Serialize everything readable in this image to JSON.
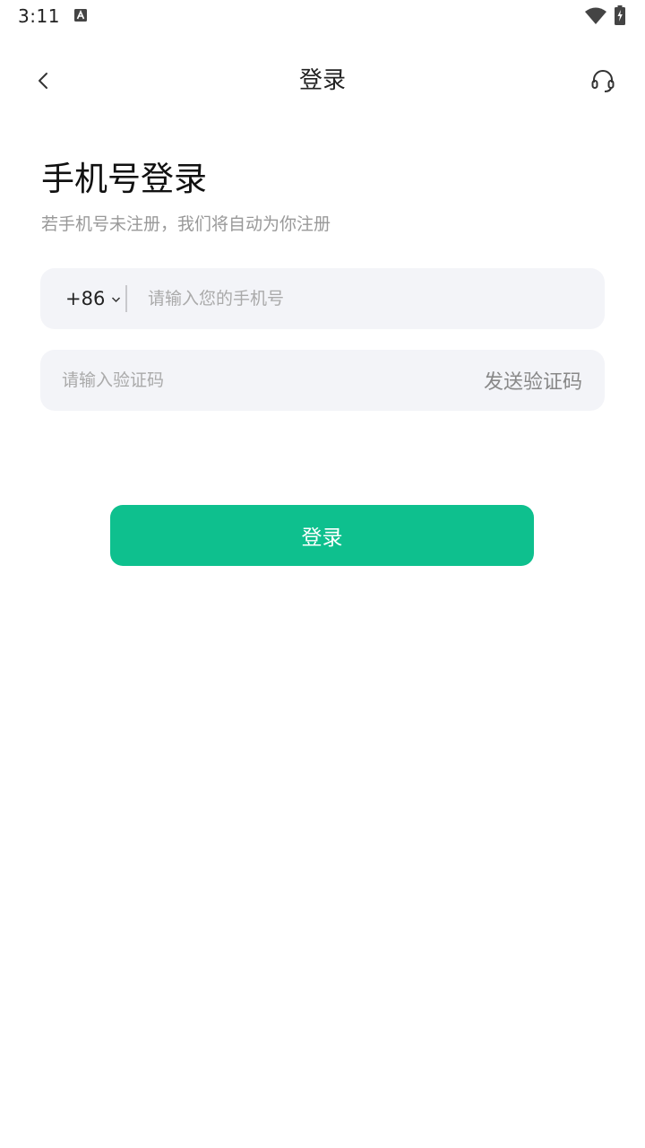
{
  "status_bar": {
    "time": "3:11",
    "icons": [
      "a-notification-icon",
      "wifi-icon",
      "battery-charging-icon"
    ]
  },
  "nav": {
    "title": "登录",
    "back_icon": "chevron-left-icon",
    "support_icon": "headset-icon"
  },
  "heading": "手机号登录",
  "subheading": "若手机号未注册，我们将自动为你注册",
  "phone": {
    "country_code": "+86",
    "placeholder": "请输入您的手机号",
    "value": ""
  },
  "code": {
    "placeholder": "请输入验证码",
    "value": "",
    "send_label": "发送验证码"
  },
  "login_button": "登录",
  "colors": {
    "accent": "#0ec08e",
    "field_bg": "#f3f4f8",
    "muted_text": "#999999"
  }
}
